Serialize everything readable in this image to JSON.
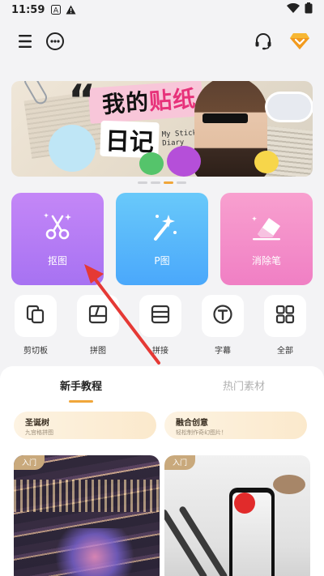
{
  "status": {
    "time": "11:59",
    "icons_left": [
      "notification-a-icon",
      "warning-icon"
    ],
    "icons_right": [
      "wifi-icon",
      "battery-icon"
    ]
  },
  "nav": {
    "left_icons": [
      "menu-icon",
      "more-dots-icon"
    ],
    "right_icons": [
      "headset-icon",
      "vip-diamond-icon"
    ]
  },
  "banner": {
    "title_part1": "我的",
    "title_highlight": "贴纸",
    "title_part2": "日记",
    "subtitle": "My Sticker Diary",
    "quote_mark": "“",
    "page_count": 4,
    "active_page": 2
  },
  "tiles": [
    {
      "label": "抠图",
      "icon": "scissors-sparkle-icon"
    },
    {
      "label": "P图",
      "icon": "magic-wand-icon"
    },
    {
      "label": "消除笔",
      "icon": "eraser-icon"
    }
  ],
  "tools": [
    {
      "label": "剪切板",
      "icon": "clipboard-icon"
    },
    {
      "label": "拼图",
      "icon": "collage-icon"
    },
    {
      "label": "拼接",
      "icon": "stitch-icon"
    },
    {
      "label": "字幕",
      "icon": "subtitle-t-icon"
    },
    {
      "label": "全部",
      "icon": "grid-all-icon"
    }
  ],
  "sheet": {
    "tabs": [
      {
        "label": "新手教程",
        "active": true
      },
      {
        "label": "热门素材",
        "active": false
      }
    ],
    "chips": [
      {
        "title": "圣诞树",
        "subtitle": "九宫格拼图"
      },
      {
        "title": "融合创意",
        "subtitle": "轻松制作奇幻图片！"
      }
    ],
    "cards": [
      {
        "badge": "入门",
        "theme": "city-night"
      },
      {
        "badge": "入门",
        "theme": "skier-phone"
      }
    ]
  },
  "colors": {
    "accent": "#f0a63a",
    "tile_cutout": "#b47df5",
    "tile_p": "#5ab8fa",
    "tile_erase": "#f390c9",
    "annotation_arrow": "#e53935"
  }
}
